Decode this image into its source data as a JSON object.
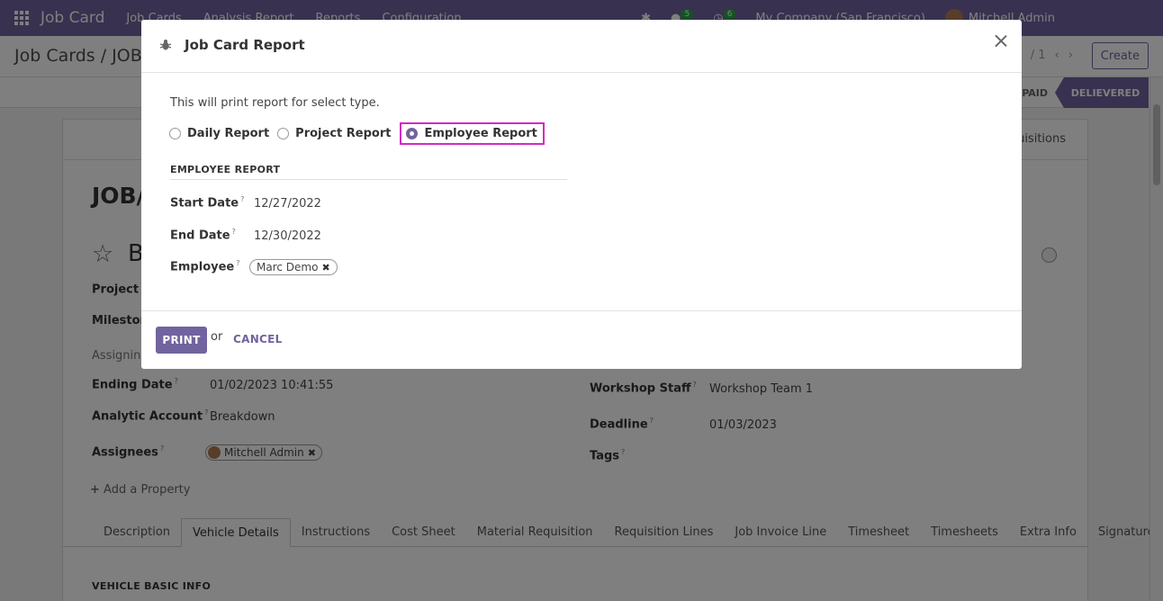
{
  "navbar": {
    "app_name": "Job Card",
    "menu": [
      "Job Cards",
      "Analysis Report",
      "Reports",
      "Configuration"
    ],
    "messages_count": "5",
    "activities_count": "6",
    "company": "My Company (San Francisco)",
    "user": "Mitchell Admin"
  },
  "control_panel": {
    "breadcrumb": "Job Cards / JOB/",
    "pager": "/ 1",
    "create_label": "Create"
  },
  "statusbar": {
    "stage_paid": "PAID",
    "stage_delivered": "DELIEVERED"
  },
  "sheet": {
    "smart_button": "uisitions",
    "record_title": "JOB/",
    "record_name": "B",
    "fields": {
      "project_label": "Project",
      "milestone_label": "Milestone",
      "assigning_label": "Assigning",
      "ending_date_label": "Ending Date",
      "ending_date_value": "01/02/2023 10:41:55",
      "analytic_label": "Analytic Account",
      "analytic_value": "Breakdown",
      "assignees_label": "Assignees",
      "assignee_value": "Mitchell Admin",
      "workshop_label": "Workshop Staff",
      "workshop_value": "Workshop Team 1",
      "deadline_label": "Deadline",
      "deadline_value": "01/03/2023",
      "tags_label": "Tags",
      "help_mark": "?"
    },
    "add_property": "Add a Property",
    "tabs": [
      "Description",
      "Vehicle Details",
      "Instructions",
      "Cost Sheet",
      "Material Requisition",
      "Requisition Lines",
      "Job Invoice Line",
      "Timesheet",
      "Timesheets",
      "Extra Info",
      "Signature"
    ],
    "active_tab": "Vehicle Details",
    "section_title": "VEHICLE BASIC INFO"
  },
  "modal": {
    "title": "Job Card Report",
    "intro": "This will print report for select type.",
    "report_types": [
      "Daily Report",
      "Project Report",
      "Employee Report"
    ],
    "selected_type": "Employee Report",
    "group_title": "EMPLOYEE REPORT",
    "start_date_label": "Start Date",
    "start_date_value": "12/27/2022",
    "end_date_label": "End Date",
    "end_date_value": "12/30/2022",
    "employee_label": "Employee",
    "employee_value": "Marc Demo",
    "print_label": "PRINT",
    "or_text": "or",
    "cancel_label": "CANCEL"
  },
  "colors": {
    "primary": "#71639e",
    "highlight_border": "#d42ac3"
  }
}
